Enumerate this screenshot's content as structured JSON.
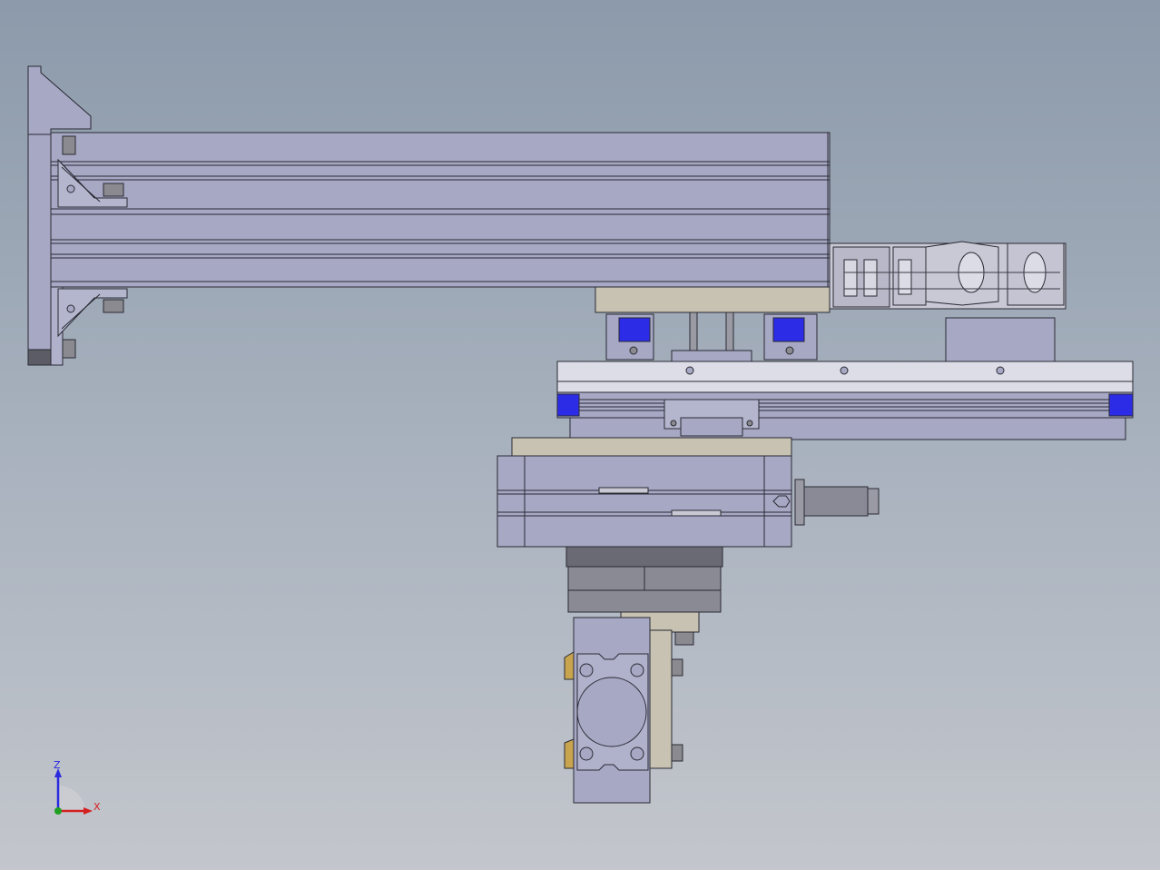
{
  "viewport": {
    "triad": {
      "z_label": "Z",
      "x_label": "X",
      "z_color": "#2a2ae0",
      "x_color": "#d42020",
      "y_color": "#20a020"
    },
    "colors": {
      "background_top": "#8c9aab",
      "background_bottom": "#c3c6cc",
      "aluminum": "#a6a8c4",
      "plate_tan": "#c7c2b2",
      "slider_blue": "#2c2ce6",
      "bracket_tan": "#c8a44e",
      "dark_gray": "#5c5c66",
      "cable_chain_light": "#c9c9d6"
    }
  }
}
